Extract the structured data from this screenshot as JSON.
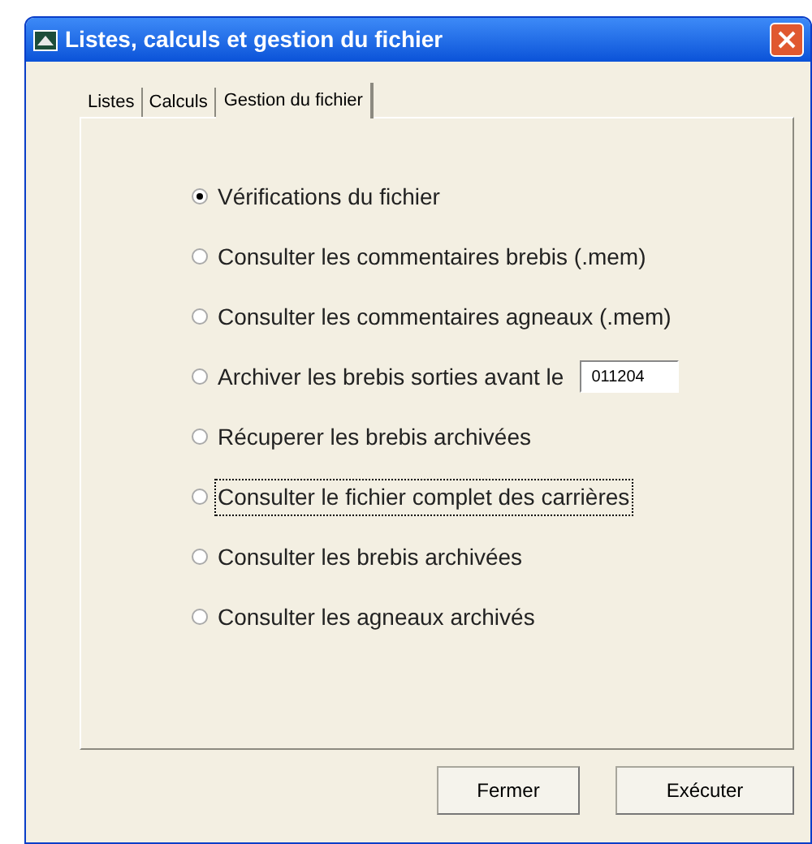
{
  "window": {
    "title": "Listes, calculs et gestion du fichier"
  },
  "tabs": [
    {
      "label": "Listes",
      "selected": false
    },
    {
      "label": "Calculs",
      "selected": false
    },
    {
      "label": "Gestion du fichier",
      "selected": true
    }
  ],
  "options": [
    {
      "kind": "radio",
      "label": "Vérifications du fichier",
      "selected": true,
      "focused": false
    },
    {
      "kind": "radio",
      "label": "Consulter les commentaires brebis (.mem)",
      "selected": false,
      "focused": false
    },
    {
      "kind": "radio",
      "label": "Consulter les commentaires agneaux (.mem)",
      "selected": false,
      "focused": false
    },
    {
      "kind": "radio-with-field",
      "label": "Archiver les brebis sorties avant le",
      "value": "011204",
      "selected": false,
      "focused": false
    },
    {
      "kind": "radio",
      "label": "Récuperer les brebis archivées",
      "selected": false,
      "focused": false
    },
    {
      "kind": "radio",
      "label": "Consulter le fichier complet des carrières",
      "selected": false,
      "focused": true
    },
    {
      "kind": "radio",
      "label": "Consulter les brebis archivées",
      "selected": false,
      "focused": false
    },
    {
      "kind": "radio",
      "label": "Consulter les agneaux archivés",
      "selected": false,
      "focused": false
    }
  ],
  "buttons": [
    "Fermer",
    "Exécuter"
  ]
}
